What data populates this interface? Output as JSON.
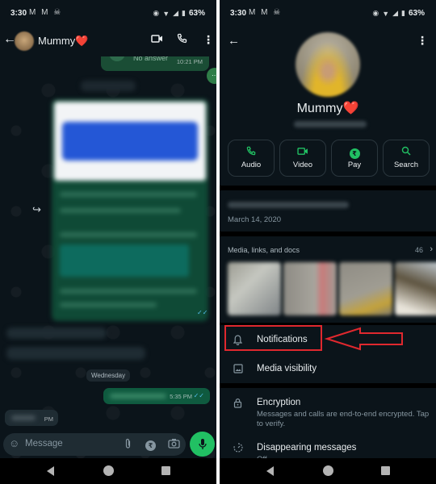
{
  "status_bar": {
    "time": "3:30",
    "notifications": "M M ☠",
    "battery": "63%"
  },
  "chat": {
    "contact_name": "Mummy❤️",
    "header_icons": [
      "back-arrow-icon",
      "video-call-icon",
      "phone-icon",
      "more-vert-icon"
    ],
    "missed_call": {
      "text": "No answer",
      "time": "10:21 PM"
    },
    "date_divider": "Wednesday",
    "sent_message_time": "5:35 PM",
    "received_message_time": "PM",
    "composer": {
      "placeholder": "Message",
      "icons": [
        "emoji-icon",
        "attach-icon",
        "rupee-icon",
        "camera-icon",
        "mic-icon"
      ]
    }
  },
  "contact_info": {
    "name": "Mummy❤️",
    "actions": [
      {
        "label": "Audio",
        "icon": "phone-icon"
      },
      {
        "label": "Video",
        "icon": "video-icon"
      },
      {
        "label": "Pay",
        "icon": "rupee-icon"
      },
      {
        "label": "Search",
        "icon": "search-icon"
      }
    ],
    "about_date": "March 14, 2020",
    "media": {
      "title": "Media, links, and docs",
      "count": "46"
    },
    "settings": [
      {
        "label": "Notifications",
        "icon": "bell-icon"
      },
      {
        "label": "Media visibility",
        "icon": "image-icon"
      },
      {
        "label": "Encryption",
        "icon": "lock-icon",
        "subtitle": "Messages and calls are end-to-end encrypted. Tap to verify."
      },
      {
        "label": "Disappearing messages",
        "icon": "timer-icon",
        "subtitle": "Off"
      }
    ]
  },
  "annotations": {
    "highlight_color": "#e0282e"
  },
  "colors": {
    "background": "#0b141a",
    "accent_green": "#21c063",
    "outgoing_bubble": "#005c4b"
  }
}
